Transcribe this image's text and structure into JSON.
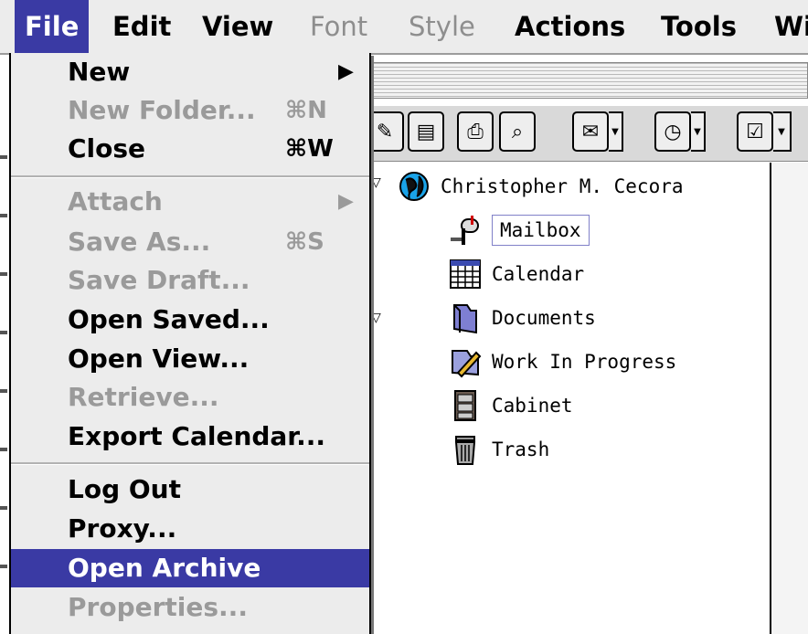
{
  "menubar": {
    "items": [
      {
        "label": "File",
        "state": "active"
      },
      {
        "label": "Edit",
        "state": "enabled"
      },
      {
        "label": "View",
        "state": "enabled"
      },
      {
        "label": "Font",
        "state": "disabled"
      },
      {
        "label": "Style",
        "state": "disabled"
      },
      {
        "label": "Actions",
        "state": "enabled"
      },
      {
        "label": "Tools",
        "state": "enabled"
      },
      {
        "label": "Wi",
        "state": "enabled"
      }
    ]
  },
  "file_menu": {
    "items": [
      {
        "label": "New",
        "shortcut": "",
        "submenu": true,
        "enabled": true
      },
      {
        "label": "New Folder...",
        "shortcut": "⌘N",
        "submenu": false,
        "enabled": false
      },
      {
        "label": "Close",
        "shortcut": "⌘W",
        "submenu": false,
        "enabled": true
      },
      {
        "label": "Attach",
        "shortcut": "",
        "submenu": true,
        "enabled": false
      },
      {
        "label": "Save As...",
        "shortcut": "⌘S",
        "submenu": false,
        "enabled": false
      },
      {
        "label": "Save Draft...",
        "shortcut": "",
        "submenu": false,
        "enabled": false
      },
      {
        "label": "Open Saved...",
        "shortcut": "",
        "submenu": false,
        "enabled": true
      },
      {
        "label": "Open View...",
        "shortcut": "",
        "submenu": false,
        "enabled": true
      },
      {
        "label": "Retrieve...",
        "shortcut": "",
        "submenu": false,
        "enabled": false
      },
      {
        "label": "Export Calendar...",
        "shortcut": "",
        "submenu": false,
        "enabled": true
      },
      {
        "label": "Log Out",
        "shortcut": "",
        "submenu": false,
        "enabled": true
      },
      {
        "label": "Proxy...",
        "shortcut": "",
        "submenu": false,
        "enabled": true
      },
      {
        "label": "Open Archive",
        "shortcut": "",
        "submenu": false,
        "enabled": true,
        "highlighted": true
      },
      {
        "label": "Properties...",
        "shortcut": "",
        "submenu": false,
        "enabled": false
      }
    ],
    "highlight_color": "#3a3aa4"
  },
  "tree": {
    "root": {
      "label": "Christopher M. Cecora",
      "icon": "globe-icon"
    },
    "children": [
      {
        "label": "Mailbox",
        "icon": "mailbox-icon",
        "selected": true
      },
      {
        "label": "Calendar",
        "icon": "calendar-icon"
      },
      {
        "label": "Documents",
        "icon": "documents-folder-icon"
      },
      {
        "label": "Work In Progress",
        "icon": "work-in-progress-icon"
      },
      {
        "label": "Cabinet",
        "icon": "cabinet-icon"
      },
      {
        "label": "Trash",
        "icon": "trash-icon"
      }
    ]
  },
  "toolbar": {
    "icons": [
      "tool-icon",
      "properties-icon",
      "print-icon",
      "find-icon",
      "new-mail-icon",
      "new-appointment-icon",
      "new-task-icon"
    ]
  }
}
